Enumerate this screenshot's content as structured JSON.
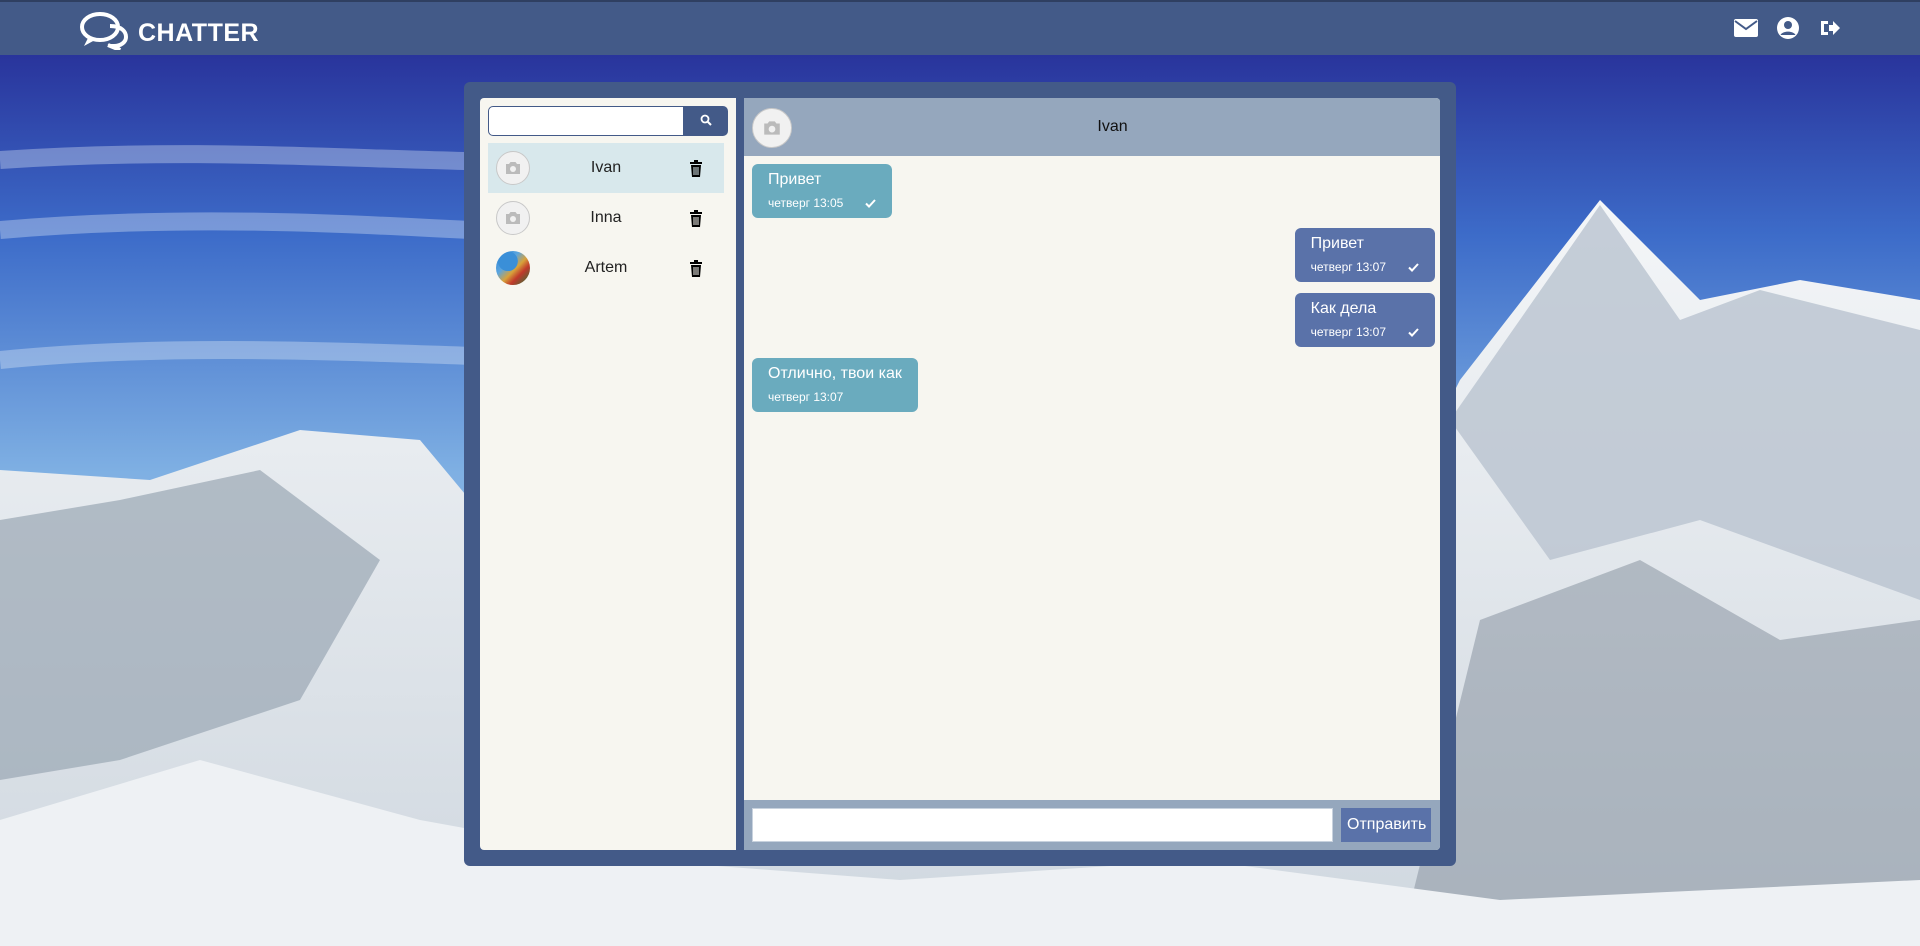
{
  "header": {
    "brand": "CHATTER",
    "icons": [
      "chat-bubbles-icon",
      "envelope-icon",
      "user-circle-icon",
      "sign-out-icon"
    ]
  },
  "sidebar": {
    "search": {
      "value": "",
      "placeholder": ""
    },
    "contacts": [
      {
        "name": "Ivan",
        "avatar": "camera-placeholder",
        "active": true
      },
      {
        "name": "Inna",
        "avatar": "camera-placeholder",
        "active": false
      },
      {
        "name": "Artem",
        "avatar": "photo",
        "active": false
      }
    ]
  },
  "chat": {
    "title": "Ivan",
    "messages": [
      {
        "direction": "in",
        "text": "Привет",
        "time": "четверг 13:05",
        "read": true
      },
      {
        "direction": "out",
        "text": "Привет",
        "time": "четверг 13:07",
        "read": true
      },
      {
        "direction": "out",
        "text": "Как дела",
        "time": "четверг 13:07",
        "read": true
      },
      {
        "direction": "in",
        "text": "Отлично, твои как",
        "time": "четверг 13:07",
        "read": false
      }
    ],
    "composer": {
      "value": "",
      "placeholder": "",
      "send_label": "Отправить"
    }
  },
  "colors": {
    "navbar": "#435a88",
    "panel_bg": "#f7f6f0",
    "active_contact": "#d8e8ec",
    "incoming_bubble": "#6aabbe",
    "outgoing_bubble": "#5a72a9",
    "chat_header": "#95a7bd"
  }
}
